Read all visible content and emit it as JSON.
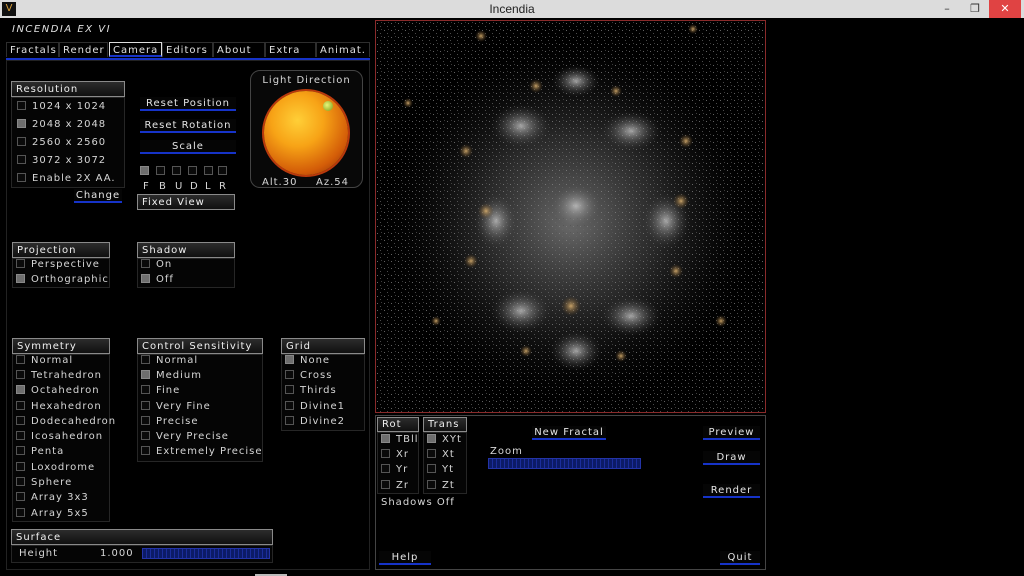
{
  "window": {
    "title": "Incendia",
    "minimize": "–",
    "maximize": "❐",
    "close": "✕",
    "icon": "V"
  },
  "app": {
    "name": "INCENDIA EX VI"
  },
  "tabs": [
    "Fractals",
    "Render",
    "Camera",
    "Editors",
    "About",
    "Extra",
    "Animat."
  ],
  "active_tab": "Camera",
  "resolution": {
    "title": "Resolution",
    "items": [
      {
        "label": "1024 x 1024",
        "checked": false
      },
      {
        "label": "2048 x 2048",
        "checked": true
      },
      {
        "label": "2560 x 2560",
        "checked": false
      },
      {
        "label": "3072 x 3072",
        "checked": false
      },
      {
        "label": "Enable 2X AA.",
        "checked": false
      }
    ],
    "change_label": "Change"
  },
  "camera_buttons": {
    "reset_position": "Reset Position",
    "reset_rotation": "Reset Rotation",
    "scale": "Scale"
  },
  "view_flags": {
    "labels": [
      "F",
      "B",
      "U",
      "D",
      "L",
      "R"
    ],
    "checked": [
      true,
      false,
      false,
      false,
      false,
      false
    ]
  },
  "fixed_view": "Fixed View",
  "light": {
    "title": "Light Direction",
    "alt": "Alt.30",
    "az": "Az.54"
  },
  "projection": {
    "title": "Projection",
    "items": [
      {
        "label": "Perspective",
        "checked": false
      },
      {
        "label": "Orthographic",
        "checked": true
      }
    ]
  },
  "shadow": {
    "title": "Shadow",
    "items": [
      {
        "label": "On",
        "checked": false
      },
      {
        "label": "Off",
        "checked": true
      }
    ]
  },
  "symmetry": {
    "title": "Symmetry",
    "items": [
      {
        "label": "Normal",
        "checked": false
      },
      {
        "label": "Tetrahedron",
        "checked": false
      },
      {
        "label": "Octahedron",
        "checked": true
      },
      {
        "label": "Hexahedron",
        "checked": false
      },
      {
        "label": "Dodecahedron",
        "checked": false
      },
      {
        "label": "Icosahedron",
        "checked": false
      },
      {
        "label": "Penta",
        "checked": false
      },
      {
        "label": "Loxodrome",
        "checked": false
      },
      {
        "label": "Sphere",
        "checked": false
      },
      {
        "label": "Array 3x3",
        "checked": false
      },
      {
        "label": "Array 5x5",
        "checked": false
      }
    ]
  },
  "control_sensitivity": {
    "title": "Control Sensitivity",
    "items": [
      {
        "label": "Normal",
        "checked": false
      },
      {
        "label": "Medium",
        "checked": true
      },
      {
        "label": "Fine",
        "checked": false
      },
      {
        "label": "Very Fine",
        "checked": false
      },
      {
        "label": "Precise",
        "checked": false
      },
      {
        "label": "Very Precise",
        "checked": false
      },
      {
        "label": "Extremely Precise",
        "checked": false
      }
    ]
  },
  "grid": {
    "title": "Grid",
    "items": [
      {
        "label": "None",
        "checked": true
      },
      {
        "label": "Cross",
        "checked": false
      },
      {
        "label": "Thirds",
        "checked": false
      },
      {
        "label": "Divine1",
        "checked": false
      },
      {
        "label": "Divine2",
        "checked": false
      }
    ]
  },
  "surface": {
    "title": "Surface",
    "height_label": "Height",
    "height_value": "1.000"
  },
  "rot": {
    "title": "Rot",
    "items": [
      {
        "label": "TBll",
        "checked": true
      },
      {
        "label": "Xr",
        "checked": false
      },
      {
        "label": "Yr",
        "checked": false
      },
      {
        "label": "Zr",
        "checked": false
      }
    ]
  },
  "trans": {
    "title": "Trans",
    "items": [
      {
        "label": "XYt",
        "checked": true
      },
      {
        "label": "Xt",
        "checked": false
      },
      {
        "label": "Yt",
        "checked": false
      },
      {
        "label": "Zt",
        "checked": false
      }
    ]
  },
  "shadows_status": "Shadows  Off",
  "bottom": {
    "new_fractal": "New Fractal",
    "zoom_label": "Zoom",
    "preview": "Preview",
    "draw": "Draw",
    "render": "Render",
    "help": "Help",
    "quit": "Quit"
  }
}
